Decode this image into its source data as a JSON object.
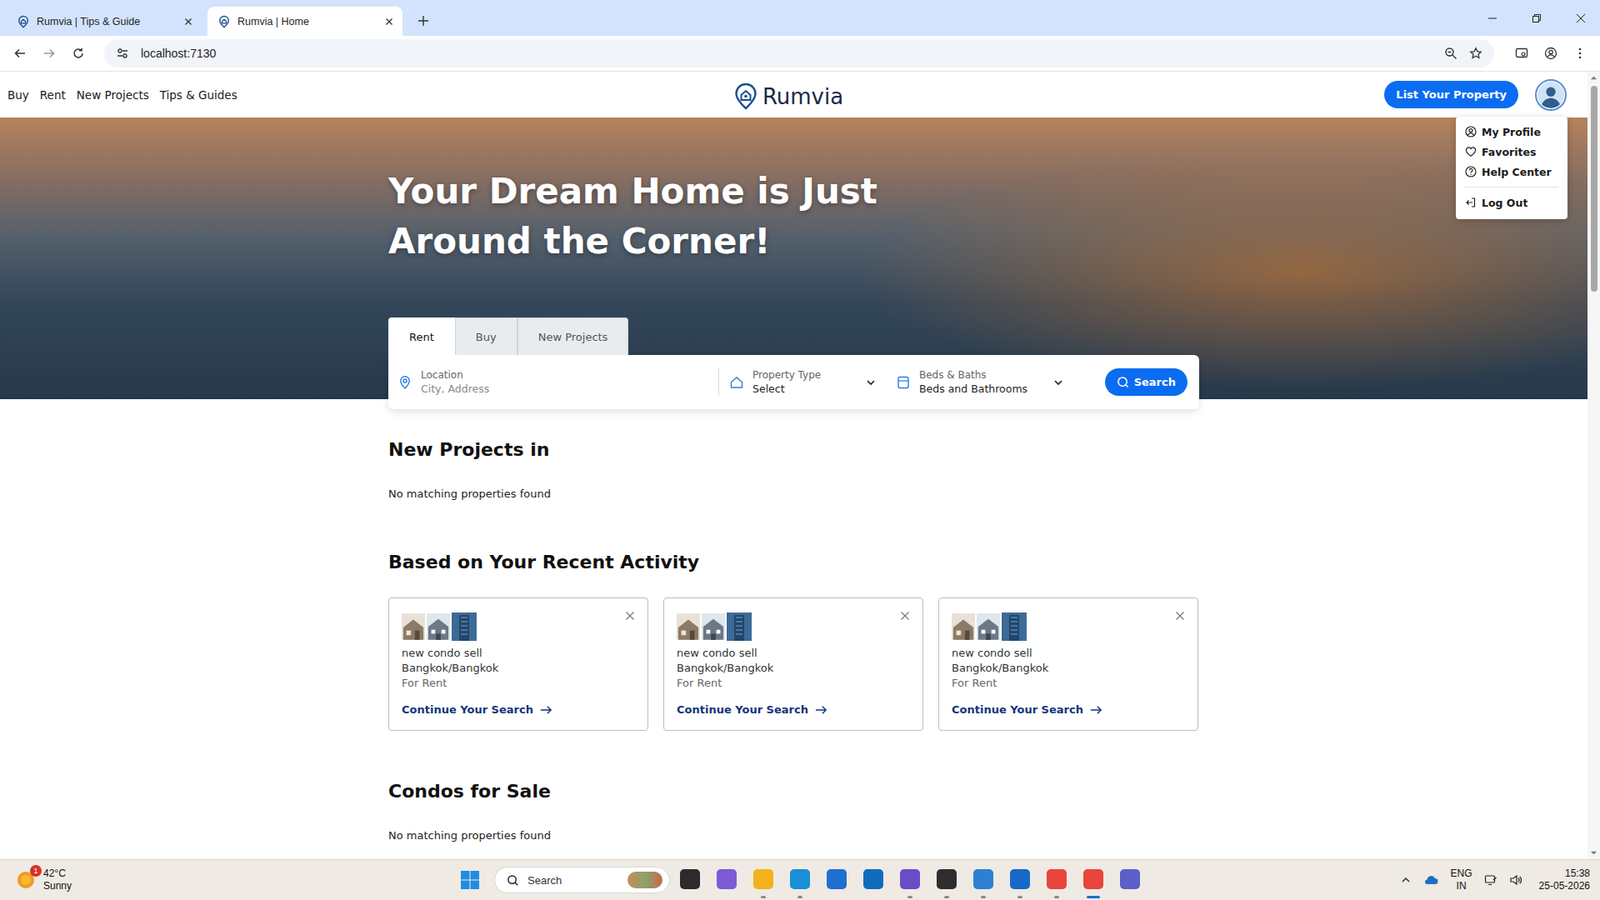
{
  "browser": {
    "tabs": [
      {
        "title": "Rumvia | Tips & Guide",
        "selected": false
      },
      {
        "title": "Rumvia | Home",
        "selected": true
      }
    ],
    "url": "localhost:7130"
  },
  "header": {
    "nav": [
      "Buy",
      "Rent",
      "New Projects",
      "Tips & Guides"
    ],
    "logo": "Rumvia",
    "list_button": "List Your Property"
  },
  "user_menu": {
    "open": true,
    "items": [
      {
        "label": "My Profile",
        "divider_before": false
      },
      {
        "label": "Favorites",
        "divider_before": false
      },
      {
        "label": "Help Center",
        "divider_before": false
      },
      {
        "label": "Log Out",
        "divider_before": true
      }
    ]
  },
  "hero": {
    "title_lines": [
      "Your Dream Home is Just",
      "Around the Corner!"
    ]
  },
  "search": {
    "tabs": [
      {
        "label": "Rent",
        "selected": true
      },
      {
        "label": "Buy",
        "selected": false
      },
      {
        "label": "New Projects",
        "selected": false
      }
    ],
    "fields": [
      {
        "kind": "text",
        "label": "Location",
        "value": "City, Address",
        "placeholder": true
      },
      {
        "kind": "select",
        "label": "Property Type",
        "value": "Select",
        "placeholder": false
      },
      {
        "kind": "select",
        "label": "Beds & Baths",
        "value": "Beds and Bathrooms",
        "placeholder": false
      }
    ],
    "button": "Search"
  },
  "sections": [
    {
      "kind": "empty",
      "title": "New Projects in",
      "empty_text": "No matching properties found"
    },
    {
      "kind": "cards",
      "title": "Based on Your Recent Activity",
      "cards": [
        {
          "title": "new condo sell",
          "location": "Bangkok/Bangkok",
          "type": "For Rent",
          "link": "Continue Your Search"
        },
        {
          "title": "new condo sell",
          "location": "Bangkok/Bangkok",
          "type": "For Rent",
          "link": "Continue Your Search"
        },
        {
          "title": "new condo sell",
          "location": "Bangkok/Bangkok",
          "type": "For Rent",
          "link": "Continue Your Search"
        }
      ]
    },
    {
      "kind": "empty",
      "title": "Condos for Sale",
      "empty_text": "No matching properties found"
    }
  ],
  "scrollbar": {
    "level": 0.27
  },
  "taskbar": {
    "weather": {
      "temp": "42°C",
      "condition": "Sunny",
      "badge": "1"
    },
    "search_placeholder": "Search",
    "apps": [
      {
        "color": "#2b2b2b",
        "running": false,
        "selected": false
      },
      {
        "color": "#7b5bd6",
        "running": false,
        "selected": false
      },
      {
        "color": "#f2b21d",
        "running": true,
        "selected": false
      },
      {
        "color": "#1b8fd6",
        "running": true,
        "selected": false
      },
      {
        "color": "#1f6fd1",
        "running": false,
        "selected": false
      },
      {
        "color": "#0f6cbd",
        "running": false,
        "selected": false
      },
      {
        "color": "#6a4cc7",
        "running": true,
        "selected": false
      },
      {
        "color": "#2d2d2d",
        "running": true,
        "selected": false
      },
      {
        "color": "#2d7fd3",
        "running": true,
        "selected": false
      },
      {
        "color": "#1769c7",
        "running": true,
        "selected": false
      },
      {
        "color": "#e8453c",
        "running": true,
        "selected": false
      },
      {
        "color": "#e8453c",
        "running": true,
        "selected": true
      },
      {
        "color": "#5b5fc7",
        "running": false,
        "selected": false
      }
    ],
    "language": [
      "ENG",
      "IN"
    ],
    "time": "15:38",
    "date": "25-05-2026"
  }
}
